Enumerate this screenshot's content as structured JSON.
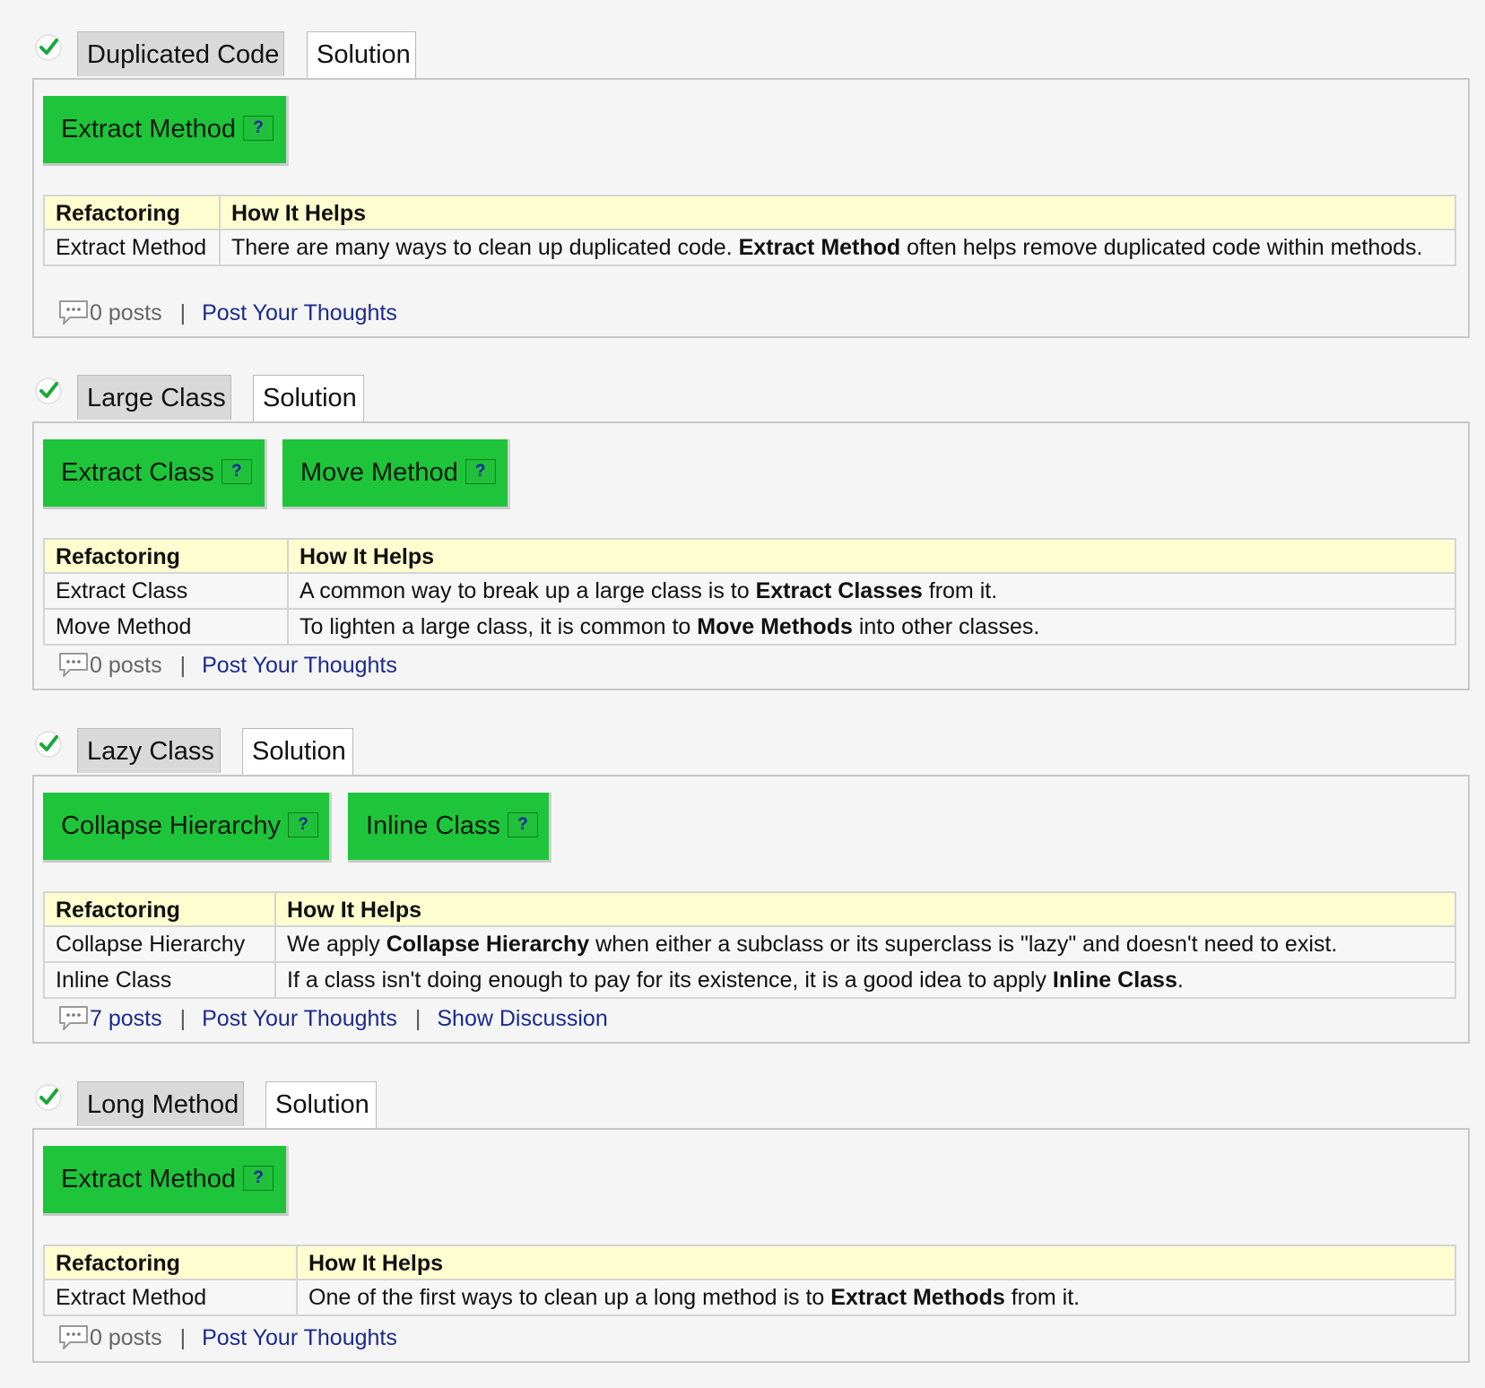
{
  "table_headers": {
    "refactoring": "Refactoring",
    "helps": "How It Helps"
  },
  "sections": [
    {
      "smell": "Duplicated Code",
      "solution_tab": "Solution",
      "buttons": [
        {
          "label": "Extract Method",
          "help": "?"
        }
      ],
      "rows": [
        {
          "name": "Extract Method",
          "pre": "There are many ways to clean up duplicated code. ",
          "bold": "Extract Method",
          "post": " often helps remove duplicated code within methods."
        }
      ],
      "posts": "0 posts",
      "post_link": "Post Your Thoughts",
      "separator": "|"
    },
    {
      "smell": "Large Class",
      "solution_tab": "Solution",
      "buttons": [
        {
          "label": "Extract Class",
          "help": "?"
        },
        {
          "label": "Move Method",
          "help": "?"
        }
      ],
      "rows": [
        {
          "name": "Extract Class",
          "pre": "A common way to break up a large class is to ",
          "bold": "Extract Classes",
          "post": " from it."
        },
        {
          "name": "Move Method",
          "pre": "To lighten a large class, it is common to ",
          "bold": "Move Methods",
          "post": " into other classes."
        }
      ],
      "posts": "0 posts",
      "post_link": "Post Your Thoughts",
      "separator": "|"
    },
    {
      "smell": "Lazy Class",
      "solution_tab": "Solution",
      "buttons": [
        {
          "label": "Collapse Hierarchy",
          "help": "?"
        },
        {
          "label": "Inline Class",
          "help": "?"
        }
      ],
      "rows": [
        {
          "name": "Collapse Hierarchy",
          "pre": "We apply ",
          "bold": "Collapse Hierarchy",
          "post": " when either a subclass or its superclass is \"lazy\" and doesn't need to exist."
        },
        {
          "name": "Inline Class",
          "pre": "If a class isn't doing enough to pay for its existence, it is a good idea to apply ",
          "bold": "Inline Class",
          "post": "."
        }
      ],
      "posts": "7 posts",
      "post_link": "Post Your Thoughts",
      "show_link": "Show Discussion",
      "separator": "|"
    },
    {
      "smell": "Long Method",
      "solution_tab": "Solution",
      "buttons": [
        {
          "label": "Extract Method",
          "help": "?"
        }
      ],
      "rows": [
        {
          "name": "Extract Method",
          "pre": "One of the first ways to clean up a long method is to ",
          "bold": "Extract Methods",
          "post": " from it."
        }
      ],
      "posts": "0 posts",
      "post_link": "Post Your Thoughts",
      "separator": "|"
    }
  ],
  "icons": {
    "status": "checkmark-icon",
    "comments": "comment-bubble-icon"
  },
  "colors": {
    "button_green": "#1ec53a",
    "table_header": "#fdfdcf",
    "link": "#1b2a8f",
    "check_green": "#1aa83a"
  }
}
